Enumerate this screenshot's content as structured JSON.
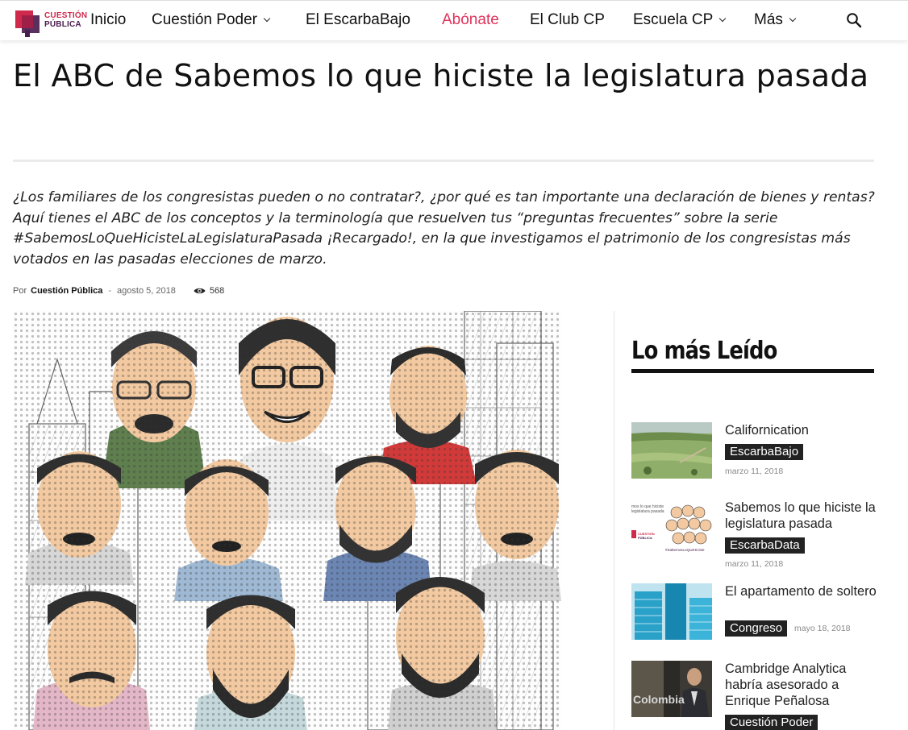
{
  "brand": {
    "name_line1": "CUESTIÓN",
    "name_line2": "PÚBLICA",
    "accent_color": "#e0325a",
    "dark_color": "#4a1d4f"
  },
  "nav": {
    "items": [
      {
        "label": "Inicio",
        "dropdown": false
      },
      {
        "label": "Cuestión Poder",
        "dropdown": true
      },
      {
        "label": "El EscarbaBajo",
        "dropdown": false
      },
      {
        "label": "Abónate",
        "dropdown": false,
        "accent": true
      },
      {
        "label": "El Club CP",
        "dropdown": false
      },
      {
        "label": "Escuela CP",
        "dropdown": true
      },
      {
        "label": "Más",
        "dropdown": true
      }
    ],
    "search_icon": "search-icon"
  },
  "article": {
    "title": "El ABC de Sabemos lo que hiciste la legislatura pasada",
    "lead": "¿Los familiares de los congresistas pueden o no contratar?, ¿por qué es tan importante una declaración de bienes y rentas? Aquí tienes el ABC de los conceptos y la terminología que resuelven tus “preguntas frecuentes” sobre la serie #SabemosLoQueHicisteLaLegislaturaPasada ¡Recargado!, en la que investigamos el patrimonio de los congresistas más votados en las pasadas elecciones de marzo.",
    "meta": {
      "by": "Por",
      "author": "Cuestión Pública",
      "separator": "-",
      "date": "agosto 5, 2018",
      "views": "568"
    }
  },
  "sidebar": {
    "title": "Lo más Leído",
    "posts": [
      {
        "title": "Californication",
        "category": "EscarbaBajo",
        "date": "marzo 11, 2018"
      },
      {
        "title": "Sabemos lo que hiciste la legislatura pasada",
        "category": "EscarbaData",
        "date": "marzo 11, 2018",
        "thumb_brand_line1": "CUESTIÓN",
        "thumb_brand_line2": "PÚBLICA",
        "thumb_caption_1": "mos lo que hiciste",
        "thumb_caption_2": "legislatura pasada",
        "thumb_tag": "#SabemosLoQueHiciste"
      },
      {
        "title": "El apartamento de soltero",
        "category": "Congreso",
        "date": "mayo 18, 2018"
      },
      {
        "title": "Cambridge Analytica habría asesorado a Enrique Peñalosa",
        "category": "Cuestión Poder",
        "date": "",
        "thumb_caption": "Colombia"
      }
    ]
  }
}
